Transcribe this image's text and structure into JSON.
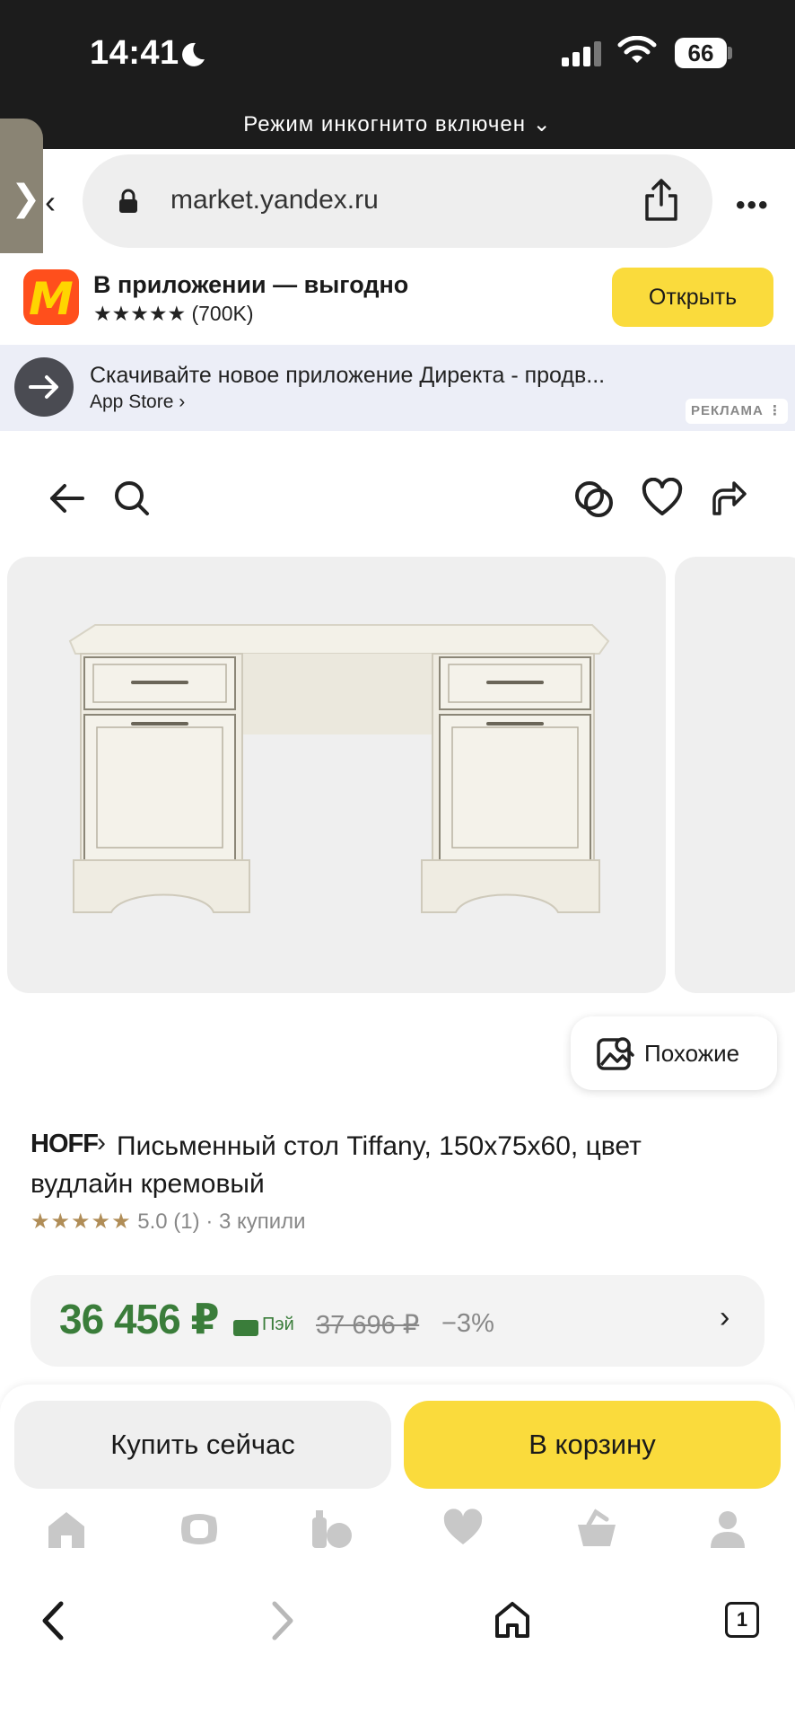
{
  "status_bar": {
    "time": "14:41",
    "battery": "66"
  },
  "incognito_banner": "Режим инкогнито включен ⌄",
  "browser": {
    "url": "market.yandex.ru",
    "tabs_count": "1"
  },
  "app_banner": {
    "title": "В приложении — выгодно",
    "rating": "★★★★★ (700K)",
    "open_label": "Открыть"
  },
  "ad": {
    "title": "Скачивайте новое приложение Директа - продв...",
    "subtitle": "App Store ›",
    "badge": "РЕКЛАМА ⋮"
  },
  "product": {
    "similar_label": "Похожие",
    "brand": "HOFF",
    "title": "Письменный стол Tiffany, 150х75х60, цвет вудлайн кремовый",
    "stars": "★★★★★",
    "rating": "5.0",
    "reviews": "(1)",
    "bought": "· 3 купили",
    "price": "36 456 ₽",
    "pay_label": "Пэй",
    "old_price": "37 696 ₽",
    "discount": "−3%",
    "buy_now_label": "Купить сейчас",
    "to_cart_label": "В корзину"
  },
  "icons": {
    "toolbar": [
      "back-arrow-icon",
      "search-icon",
      "compare-icon",
      "heart-icon",
      "share-icon"
    ],
    "bottom_nav": [
      "home-icon",
      "discounts-icon",
      "catalog-icon",
      "favorites-icon",
      "cart-icon",
      "profile-icon"
    ],
    "browser_nav": [
      "back-chevron-icon",
      "forward-chevron-icon",
      "home-icon",
      "tabs-icon"
    ]
  },
  "colors": {
    "accent_yellow": "#fadb3c",
    "price_green": "#3a7d3a",
    "ad_bg": "#eceef7"
  }
}
